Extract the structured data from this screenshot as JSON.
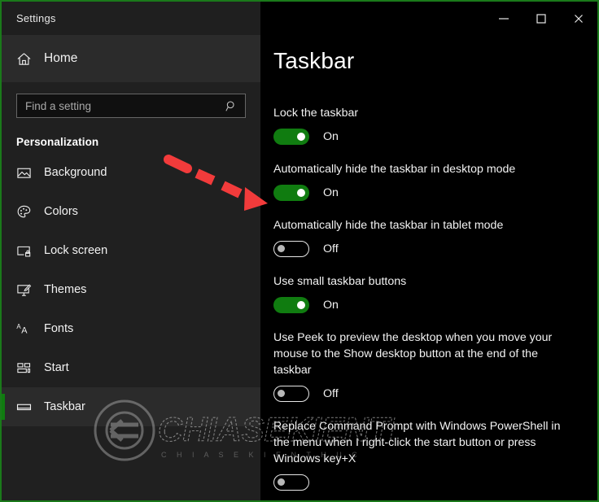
{
  "window": {
    "app_title": "Settings",
    "controls": [
      {
        "name": "minimize",
        "glyph": "minimize-icon"
      },
      {
        "name": "maximize",
        "glyph": "maximize-icon"
      },
      {
        "name": "close",
        "glyph": "close-icon"
      }
    ],
    "accent_color": "#107c10",
    "border_color": "#1a7a1a",
    "sidebar_bg": "#202020",
    "content_bg": "#000000"
  },
  "sidebar": {
    "home_label": "Home",
    "home_icon": "home-icon",
    "search": {
      "placeholder": "Find a setting",
      "value": "",
      "icon": "search-icon"
    },
    "group_title": "Personalization",
    "items": [
      {
        "label": "Background",
        "icon": "image-icon",
        "selected": false
      },
      {
        "label": "Colors",
        "icon": "palette-icon",
        "selected": false
      },
      {
        "label": "Lock screen",
        "icon": "lock-screen-icon",
        "selected": false
      },
      {
        "label": "Themes",
        "icon": "themes-icon",
        "selected": false
      },
      {
        "label": "Fonts",
        "icon": "fonts-icon",
        "selected": false
      },
      {
        "label": "Start",
        "icon": "start-tiles-icon",
        "selected": false
      },
      {
        "label": "Taskbar",
        "icon": "taskbar-icon",
        "selected": true
      }
    ]
  },
  "main": {
    "page_title": "Taskbar",
    "settings": [
      {
        "label": "Lock the taskbar",
        "state_label": "On",
        "state": "on"
      },
      {
        "label": "Automatically hide the taskbar in desktop mode",
        "state_label": "On",
        "state": "on"
      },
      {
        "label": "Automatically hide the taskbar in tablet mode",
        "state_label": "Off",
        "state": "off"
      },
      {
        "label": "Use small taskbar buttons",
        "state_label": "On",
        "state": "on"
      },
      {
        "label": "Use Peek to preview the desktop when you move your mouse to the Show desktop button at the end of the taskbar",
        "state_label": "Off",
        "state": "off"
      },
      {
        "label": "Replace Command Prompt with Windows PowerShell in the menu when I right-click the start button or press Windows key+X",
        "state_label": "",
        "state": "off"
      }
    ]
  },
  "annotation": {
    "arrow_color": "#f23b3b",
    "arrow_name": "red-dashed-arrow"
  },
  "watermark": {
    "text": "CHIASEKIENTHUC",
    "subtitle": "C H I A S E K I E N T H U C"
  }
}
